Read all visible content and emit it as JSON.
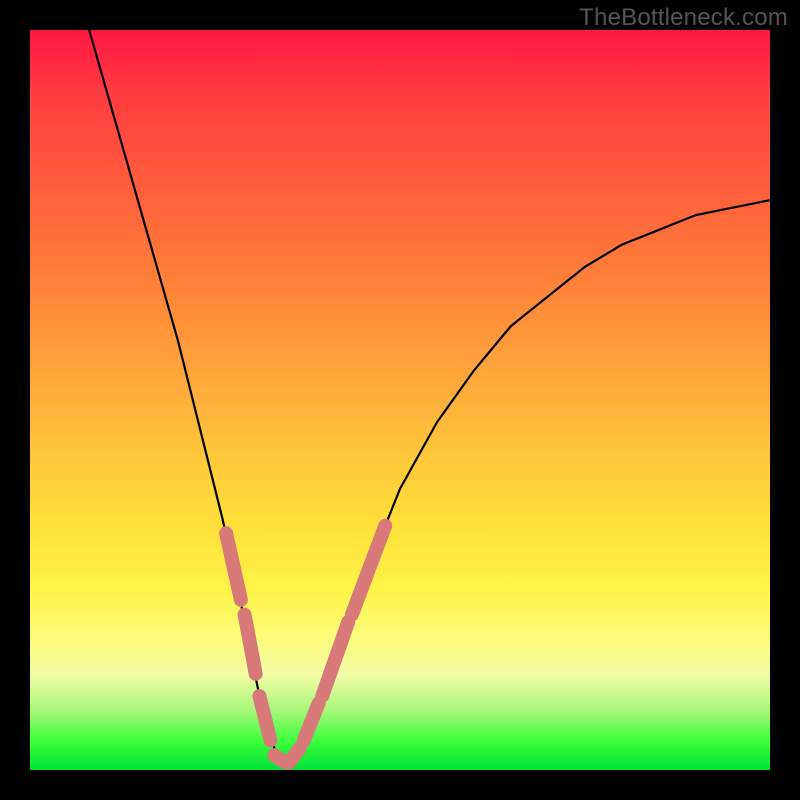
{
  "watermark": "TheBottleneck.com",
  "colors": {
    "background": "#000000",
    "gradient_top": "#ff1744",
    "gradient_mid1": "#ff7b3a",
    "gradient_mid2": "#ffe23a",
    "gradient_bottom": "#00e23a",
    "curve": "#000000",
    "overlay": "#d87a7a"
  },
  "chart_data": {
    "type": "line",
    "title": "",
    "xlabel": "",
    "ylabel": "",
    "xlim": [
      0,
      100
    ],
    "ylim": [
      0,
      100
    ],
    "series": [
      {
        "name": "bottleneck-curve",
        "x": [
          8,
          10,
          12,
          14,
          16,
          18,
          20,
          22,
          24,
          26,
          28,
          30,
          31,
          32,
          33,
          34,
          35,
          36,
          38,
          40,
          42,
          44,
          46,
          48,
          50,
          55,
          60,
          65,
          70,
          75,
          80,
          85,
          90,
          95,
          100
        ],
        "y": [
          100,
          93,
          86,
          79,
          72,
          65,
          58,
          50,
          42,
          34,
          25,
          15,
          10,
          6,
          3,
          1,
          1,
          2,
          5,
          10,
          16,
          22,
          28,
          33,
          38,
          47,
          54,
          60,
          64,
          68,
          71,
          73,
          75,
          76,
          77
        ]
      }
    ],
    "overlay_segments": [
      {
        "name": "left-upper",
        "x": [
          26.5,
          28.5
        ],
        "y": [
          32,
          23
        ]
      },
      {
        "name": "left-mid",
        "x": [
          29.0,
          30.5
        ],
        "y": [
          21,
          13
        ]
      },
      {
        "name": "left-lower",
        "x": [
          31.0,
          32.5
        ],
        "y": [
          10,
          4
        ]
      },
      {
        "name": "trough-left",
        "x": [
          33.0,
          34.5
        ],
        "y": [
          2,
          1
        ]
      },
      {
        "name": "trough-right",
        "x": [
          35.0,
          36.5
        ],
        "y": [
          1,
          3
        ]
      },
      {
        "name": "right-lower",
        "x": [
          37.0,
          39.0
        ],
        "y": [
          4,
          9
        ]
      },
      {
        "name": "right-mid",
        "x": [
          39.5,
          43.0
        ],
        "y": [
          10,
          20
        ]
      },
      {
        "name": "right-upper",
        "x": [
          43.5,
          48.0
        ],
        "y": [
          21,
          33
        ]
      }
    ],
    "annotations": []
  }
}
